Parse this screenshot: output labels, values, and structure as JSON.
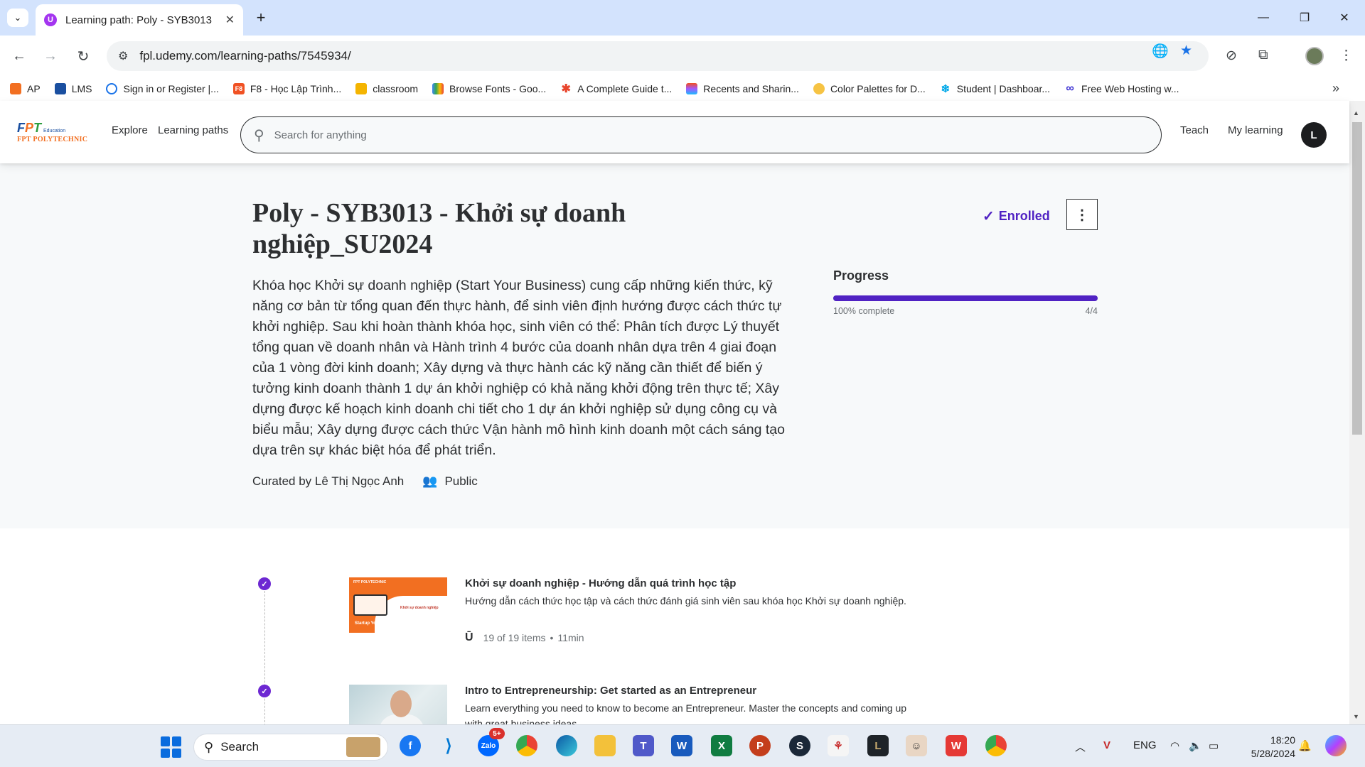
{
  "browser": {
    "tab_title": "Learning path: Poly - SYB3013 -",
    "url": "fpl.udemy.com/learning-paths/7545934/",
    "bookmarks": [
      {
        "label": "AP",
        "icon": "fpt-icon",
        "color": "#f26f21"
      },
      {
        "label": "LMS",
        "icon": "fpt-icon",
        "color": "#1a4fa0"
      },
      {
        "label": "Sign in or Register |...",
        "icon": "circle-icon",
        "color": "#1a73e8"
      },
      {
        "label": "F8 - Học Lập Trình...",
        "icon": "f8-icon",
        "color": "#f05123"
      },
      {
        "label": "classroom",
        "icon": "classroom-icon",
        "color": "#f4b400"
      },
      {
        "label": "Browse Fonts - Goo...",
        "icon": "google-fonts-icon",
        "color": "#4285f4"
      },
      {
        "label": "A Complete Guide t...",
        "icon": "asterisk-icon",
        "color": "#e8452c"
      },
      {
        "label": "Recents and Sharin...",
        "icon": "figma-icon",
        "color": "#a259ff"
      },
      {
        "label": "Color Palettes for D...",
        "icon": "palette-icon",
        "color": "#f6c343"
      },
      {
        "label": "Student | Dashboar...",
        "icon": "snowflake-icon",
        "color": "#00a8e8"
      },
      {
        "label": "Free Web Hosting w...",
        "icon": "infinity-icon",
        "color": "#3a2fd2"
      }
    ]
  },
  "header": {
    "logo": {
      "fpt": "FPT",
      "education": "Education",
      "polytechnic": "FPT POLYTECHNIC"
    },
    "nav": {
      "explore": "Explore",
      "learning_paths": "Learning paths"
    },
    "search_placeholder": "Search for anything",
    "teach": "Teach",
    "my_learning": "My learning",
    "avatar_initial": "L"
  },
  "path": {
    "title": "Poly - SYB3013 - Khởi sự doanh nghiệp_SU2024",
    "description": "Khóa học Khởi sự doanh nghiệp (Start Your Business) cung cấp những kiến thức, kỹ năng cơ bản từ tổng quan đến thực hành, để sinh viên định hướng được cách thức tự khởi nghiệp. Sau khi hoàn thành khóa học, sinh viên có thể: Phân tích được Lý thuyết tổng quan về doanh nhân và Hành trình 4 bước của doanh nhân dựa trên 4 giai đoạn của 1 vòng đời kinh doanh; Xây dựng và thực hành các kỹ năng cần thiết để biến ý tưởng kinh doanh thành 1 dự án khởi nghiệp có khả năng khởi động trên thực tế; Xây dựng được kế hoạch kinh doanh chi tiết cho 1 dự án khởi nghiệp sử dụng công cụ và biểu mẫu; Xây dựng được cách thức Vận hành mô hình kinh doanh một cách sáng tạo dựa trên sự khác biệt hóa để phát triển.",
    "curated_by": "Curated by Lê Thị Ngọc Anh",
    "visibility": "Public",
    "enrolled_label": "Enrolled",
    "progress": {
      "label": "Progress",
      "fraction": 1.0,
      "percent_text": "100% complete",
      "count_text": "4/4"
    }
  },
  "courses": [
    {
      "title": "Khởi sự doanh nghiệp - Hướng dẫn quá trình học tập",
      "description": "Hướng dẫn cách thức học tập và cách thức đánh giá sinh viên sau khóa học Khởi sự doanh nghiệp.",
      "items": "19 of 19 items",
      "duration": "11min",
      "thumb_text": "Startup Your Business"
    },
    {
      "title": "Intro to Entrepreneurship: Get started as an Entrepreneur",
      "description": "Learn everything you need to know to become an Entrepreneur. Master the concepts and coming up with great business ideas"
    }
  ],
  "taskbar": {
    "search_label": "Search",
    "zalo_badge": "5+",
    "language": "ENG",
    "time": "18:20",
    "date": "5/28/2024"
  }
}
